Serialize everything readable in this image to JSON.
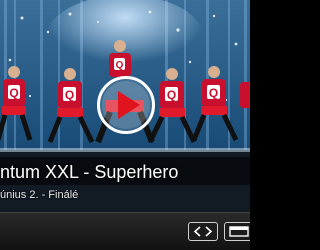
{
  "video": {
    "title": "ntum XXL - Superhero",
    "subtitle": "únius 2. - Finálé"
  },
  "overlay": {
    "play_icon": "play-icon",
    "play_color": "#e0141e"
  },
  "stage": {
    "costume_letter": "Q",
    "costume_color": "#c8102e",
    "backdrop_color": "#1b4f7a"
  },
  "controls": {
    "embed_icon": "code-icon",
    "expand_icon": "expand-icon"
  }
}
